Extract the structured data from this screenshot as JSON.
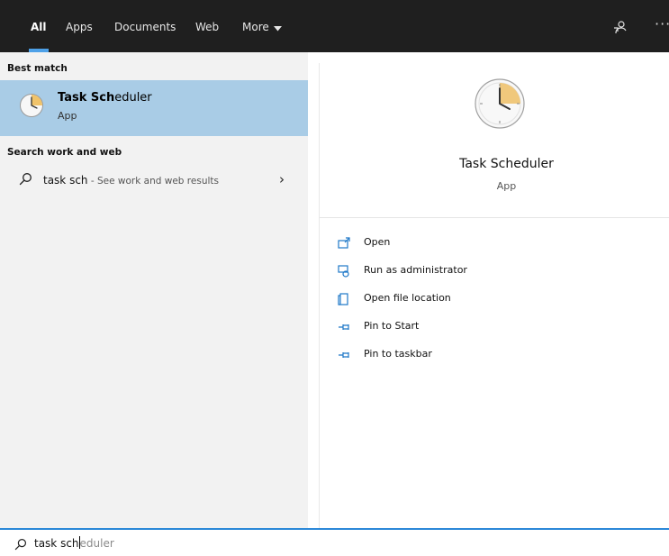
{
  "tabs": [
    {
      "label": "All",
      "active": true
    },
    {
      "label": "Apps"
    },
    {
      "label": "Documents"
    },
    {
      "label": "Web"
    },
    {
      "label": "More"
    }
  ],
  "topbar_icons": [
    "feedback-icon",
    "more-options-icon"
  ],
  "more_options_glyph": "···",
  "best_match": {
    "heading": "Best match",
    "name_bold": "Task Sch",
    "name_rest": "eduler",
    "type": "App",
    "icon": "clock-icon"
  },
  "search_work_web": {
    "heading": "Search work and web",
    "query": "task sch",
    "hint": " - See work and web results",
    "chevron": "›"
  },
  "detail": {
    "title": "Task Scheduler",
    "type": "App",
    "actions": [
      {
        "label": "Open",
        "icon": "open-icon"
      },
      {
        "label": "Run as administrator",
        "icon": "run-as-admin-icon"
      },
      {
        "label": "Open file location",
        "icon": "file-location-icon"
      },
      {
        "label": "Pin to Start",
        "icon": "pin-icon"
      },
      {
        "label": "Pin to taskbar",
        "icon": "pin-icon"
      }
    ]
  },
  "search_box": {
    "typed": "task sch",
    "suggestion": "eduler"
  },
  "colors": {
    "topbar": "#1f1f1f",
    "accent": "#2b88d8",
    "selected": "#a9cce6",
    "left_panel": "#f2f2f2"
  }
}
